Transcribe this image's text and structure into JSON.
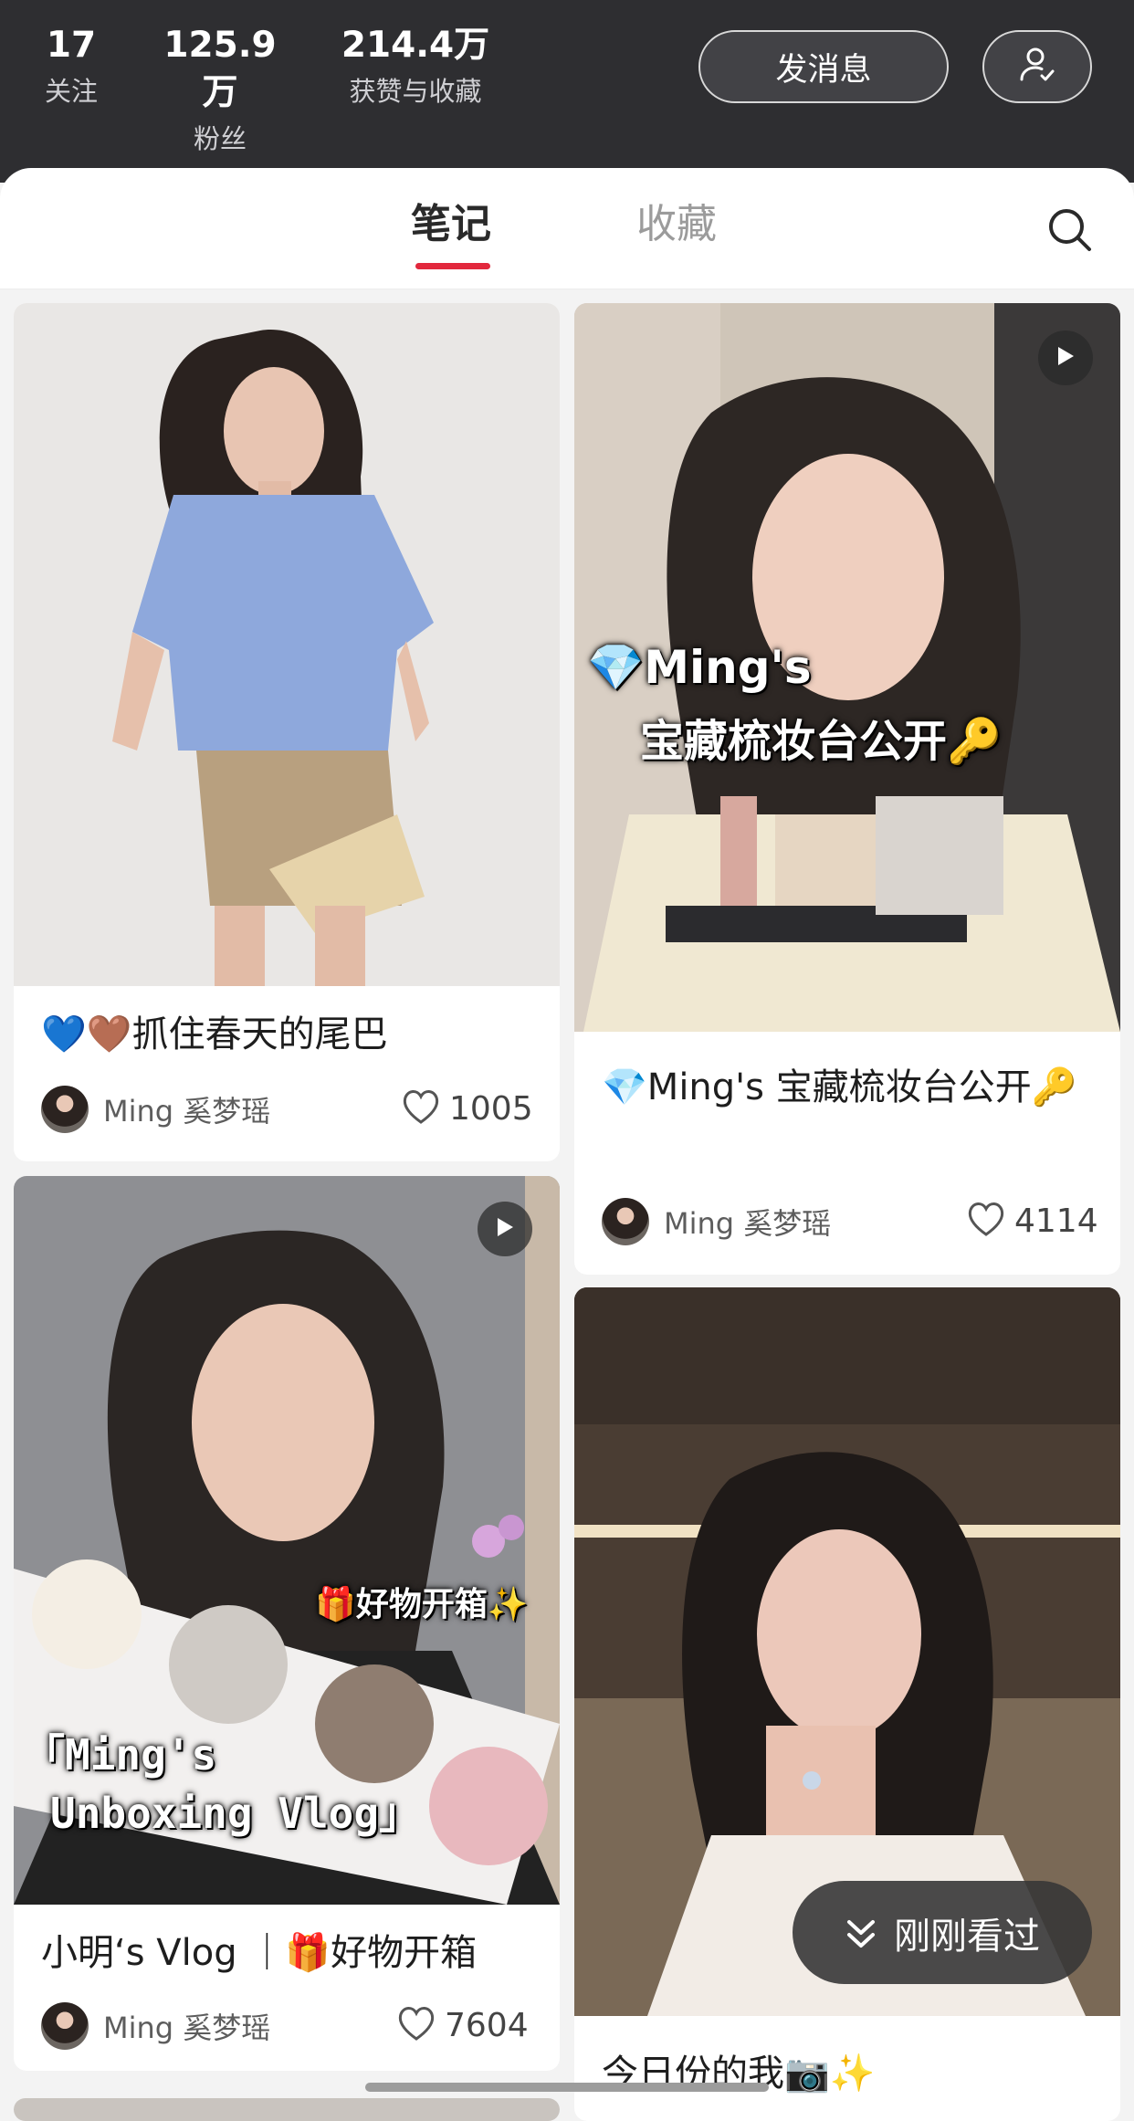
{
  "profile_stats": [
    {
      "value": "17",
      "label": "关注"
    },
    {
      "value": "125.9万",
      "label": "粉丝"
    },
    {
      "value": "214.4万",
      "label": "获赞与收藏"
    }
  ],
  "header": {
    "message_button": "发消息",
    "user_icon": "user-check-icon"
  },
  "tabs": {
    "notes": "笔记",
    "collections": "收藏",
    "search_icon": "search-icon"
  },
  "cards": [
    {
      "title": "💙🤎抓住春天的尾巴",
      "author": "Ming 奚梦瑶",
      "likes": "1005"
    },
    {
      "title": "💎Ming's 宝藏梳妆台公开🔑",
      "author": "Ming 奚梦瑶",
      "likes": "4114",
      "overlay_line1": "💎Ming's",
      "overlay_line2": "宝藏梳妆台公开🔑"
    },
    {
      "title": "小明‘s Vlog ｜🎁好物开箱",
      "author": "Ming 奚梦瑶",
      "likes": "7604",
      "overlay_tag": "🎁好物开箱✨",
      "overlay_line1": "「Ming's",
      "overlay_line2": "Unboxing Vlog」"
    },
    {
      "title": "今日份的我📷✨"
    }
  ],
  "recent_button": "刚刚看过",
  "colors": {
    "accent": "#e2283d",
    "header_bg": "#2e2e31"
  }
}
